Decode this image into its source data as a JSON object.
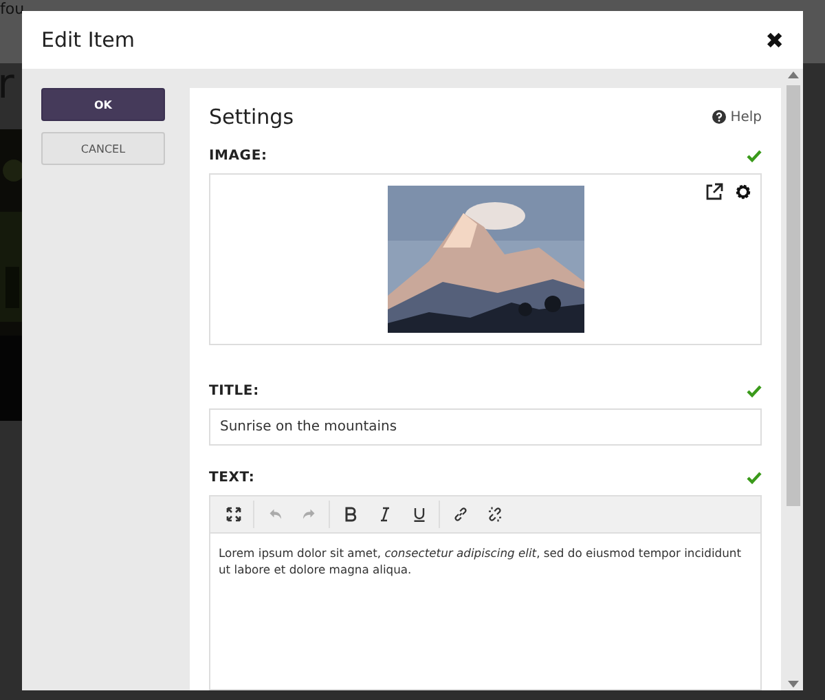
{
  "background": {
    "top_text": "fou",
    "heading": "r"
  },
  "dialog": {
    "title": "Edit Item",
    "close": "✖"
  },
  "actions": [
    {
      "label": "OK",
      "kind": "primary"
    },
    {
      "label": "CANCEL",
      "kind": "secondary"
    }
  ],
  "settings": {
    "title": "Settings",
    "help": "Help",
    "image": {
      "label": "IMAGE:",
      "valid": true,
      "kind": "picture"
    },
    "title_field": {
      "label": "TITLE:",
      "valid": true,
      "value": "Sunrise on the mountains"
    },
    "text_field": {
      "label": "TEXT:",
      "valid": true,
      "content": "Lorem ipsum dolor sit amet, *consectetur adipiscing elit*, sed do eiusmod tempor incididunt ut labore et dolore magna aliqua.",
      "toolbar": [
        {
          "kind": "fullscreen",
          "disabled": false
        },
        {
          "kind": "undo",
          "disabled": true
        },
        {
          "kind": "redo",
          "disabled": true
        },
        {
          "kind": "bold",
          "disabled": false
        },
        {
          "kind": "italic",
          "disabled": false
        },
        {
          "kind": "underline",
          "disabled": false
        },
        {
          "kind": "link",
          "disabled": false
        },
        {
          "kind": "unlink",
          "disabled": false
        }
      ]
    }
  }
}
